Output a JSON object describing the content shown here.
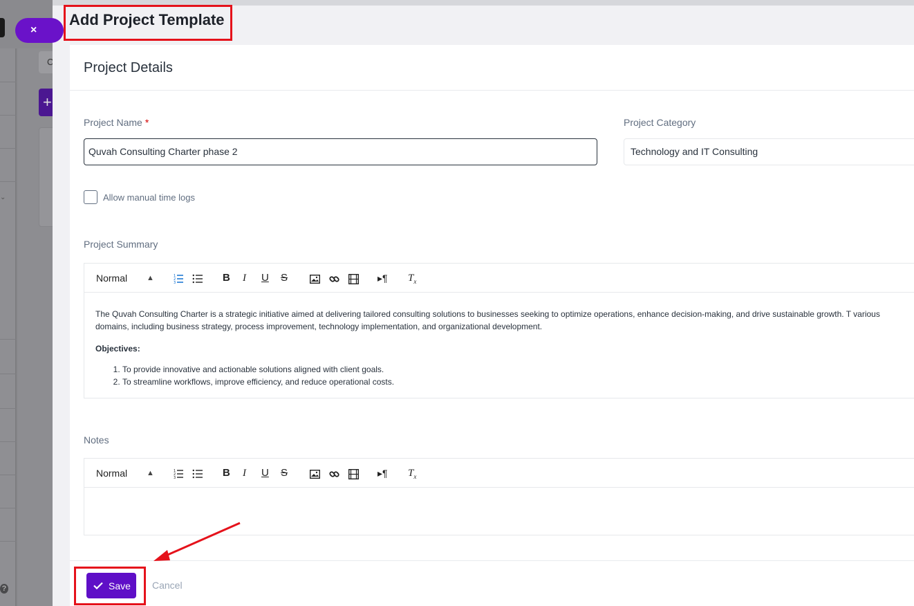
{
  "background": {
    "close_label": "×",
    "add_label": "+",
    "tab_letter": "C",
    "help_label": "?",
    "chevron": "⌄"
  },
  "panel": {
    "title": "Add Project Template"
  },
  "card": {
    "header_title": "Project Details"
  },
  "form": {
    "project_name_label": "Project Name",
    "required_marker": "*",
    "project_name_value": "Quvah Consulting Charter phase 2",
    "project_category_label": "Project Category",
    "project_category_value": "Technology and IT Consulting",
    "allow_manual_label": "Allow manual time logs",
    "summary_label": "Project Summary",
    "notes_label": "Notes"
  },
  "editor": {
    "format_select": "Normal",
    "icons": [
      "ordered-list-icon",
      "bullet-list-icon",
      "bold-icon",
      "italic-icon",
      "underline-icon",
      "strike-icon",
      "image-icon",
      "link-icon",
      "video-icon",
      "text-direction-icon",
      "clear-format-icon"
    ]
  },
  "summary": {
    "paragraph": "The Quvah Consulting Charter is a strategic initiative aimed at delivering tailored consulting solutions to businesses seeking to optimize operations, enhance decision-making, and drive sustainable growth. T various domains, including business strategy, process improvement, technology implementation, and organizational development.",
    "objectives_heading": "Objectives:",
    "objectives": [
      "To provide innovative and actionable solutions aligned with client goals.",
      "To streamline workflows, improve efficiency, and reduce operational costs."
    ]
  },
  "footer": {
    "save_label": "Save",
    "cancel_label": "Cancel"
  },
  "colors": {
    "accent": "#5f0fc7",
    "highlight": "#e5121b"
  }
}
